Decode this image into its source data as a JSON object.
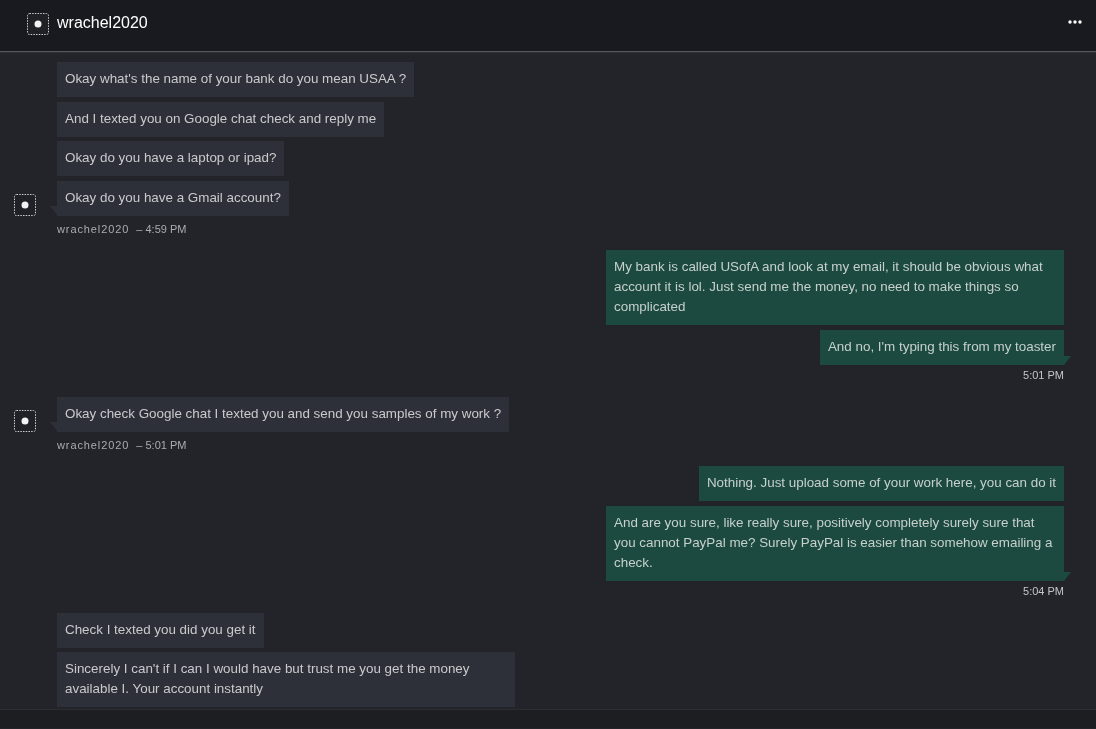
{
  "header": {
    "title": "wrachel2020"
  },
  "groups": [
    {
      "kind": "incoming",
      "sender": "wrachel2020",
      "time": "– 4:59 PM",
      "messages": [
        "Okay what's the name of your bank do you mean USAA ?",
        "And I texted you on Google chat check and reply me",
        "Okay do you have a laptop or ipad?",
        "Okay do you have a Gmail account?"
      ]
    },
    {
      "kind": "outgoing",
      "time": "5:01 PM",
      "messages": [
        "My bank is called USofA and look at my email, it should be obvious what account it is lol. Just send me the money, no need to make things so complicated",
        "And no, I'm typing this from my toaster"
      ]
    },
    {
      "kind": "incoming",
      "sender": "wrachel2020",
      "time": "– 5:01 PM",
      "messages": [
        "Okay check Google chat I texted you and send you samples of my work ?"
      ]
    },
    {
      "kind": "outgoing",
      "time": "5:04 PM",
      "messages": [
        "Nothing. Just upload some of your work here, you can do it",
        "And are you sure, like really sure, positively completely surely sure that you cannot PayPal me? Surely PayPal is easier than somehow emailing a check."
      ]
    },
    {
      "kind": "incoming",
      "messages": [
        "Check I texted you did you get it",
        "Sincerely I can't if I can I would have but trust me you get the money available I. Your account instantly"
      ]
    }
  ]
}
